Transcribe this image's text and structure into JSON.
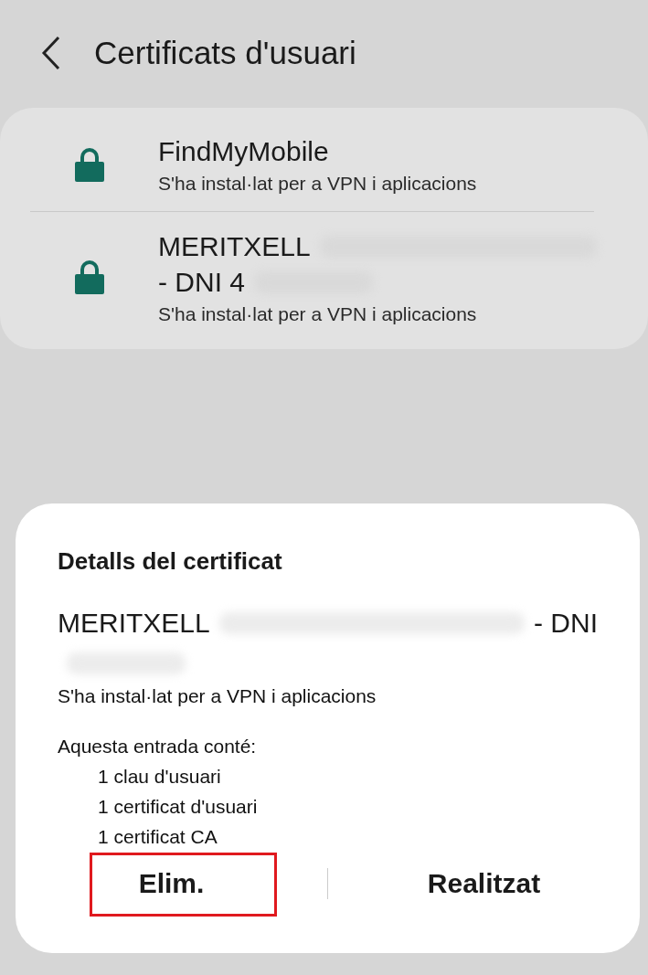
{
  "header": {
    "title": "Certificats d'usuari"
  },
  "certificates": [
    {
      "name_lines": [
        [
          {
            "kind": "text",
            "text": "FindMyMobile"
          }
        ]
      ],
      "subtitle": "S'ha instal·lat per a VPN i aplicacions"
    },
    {
      "name_lines": [
        [
          {
            "kind": "text",
            "text": "MERITXELL"
          },
          {
            "kind": "blur"
          }
        ],
        [
          {
            "kind": "text",
            "text": "- DNI 4"
          },
          {
            "kind": "blur_short"
          }
        ]
      ],
      "subtitle": "S'ha instal·lat per a VPN i aplicacions"
    }
  ],
  "dialog": {
    "title": "Detalls del certificat",
    "name_lines": [
      [
        {
          "kind": "text",
          "text": "MERITXELL"
        },
        {
          "kind": "blur"
        },
        {
          "kind": "text",
          "text": "- DNI"
        }
      ],
      [
        {
          "kind": "blur_short"
        }
      ]
    ],
    "subtitle": "S'ha instal·lat per a VPN i aplicacions",
    "contents_label": "Aquesta entrada conté:",
    "contents": [
      "1 clau d'usuari",
      "1 certificat d'usuari",
      "1 certificat CA"
    ],
    "buttons": [
      {
        "label": "Elim.",
        "highlighted": true
      },
      {
        "label": "Realitzat",
        "highlighted": false
      }
    ]
  }
}
